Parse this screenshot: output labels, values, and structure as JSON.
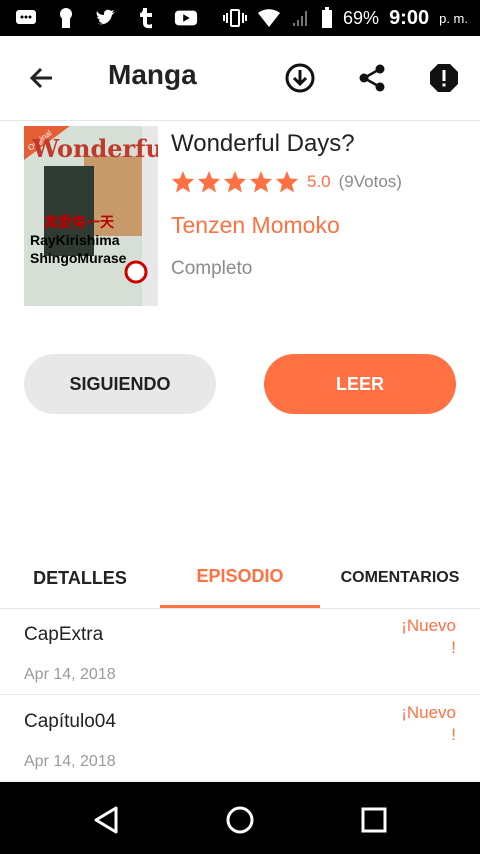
{
  "status_bar": {
    "battery": "69%",
    "time": "9:00",
    "ampm": "p. m."
  },
  "app_bar": {
    "title": "Manga",
    "icons": [
      "back-arrow-icon",
      "download-icon",
      "share-icon",
      "report-icon"
    ]
  },
  "manga": {
    "title": "Wonderful Days?",
    "rating_stars": 5,
    "score": "5.0",
    "votes": "(9Votos)",
    "author": "Tenzen Momoko",
    "status": "Completo"
  },
  "cover": {
    "badge": "Original",
    "logo": "Wonderful",
    "jp_text": "真愛毎一天",
    "name1": "RayKirishima",
    "name2": "ShingoMurase"
  },
  "buttons": {
    "follow": "SIGUIENDO",
    "read": "LEER"
  },
  "tabs": [
    {
      "label": "DETALLES",
      "active": false
    },
    {
      "label": "EPISODIO",
      "active": true
    },
    {
      "label": "COMENTARIOS",
      "active": false
    }
  ],
  "episodes": [
    {
      "title": "CapExtra",
      "date": "Apr 14, 2018",
      "badge": "¡Nuevo !"
    },
    {
      "title": "Capítulo04",
      "date": "Apr 14, 2018",
      "badge": "¡Nuevo !"
    }
  ],
  "colors": {
    "accent": "#ff7043",
    "button_gray": "#e8e8e8",
    "text_dark": "#222222",
    "text_gray": "#8a8a8a"
  }
}
